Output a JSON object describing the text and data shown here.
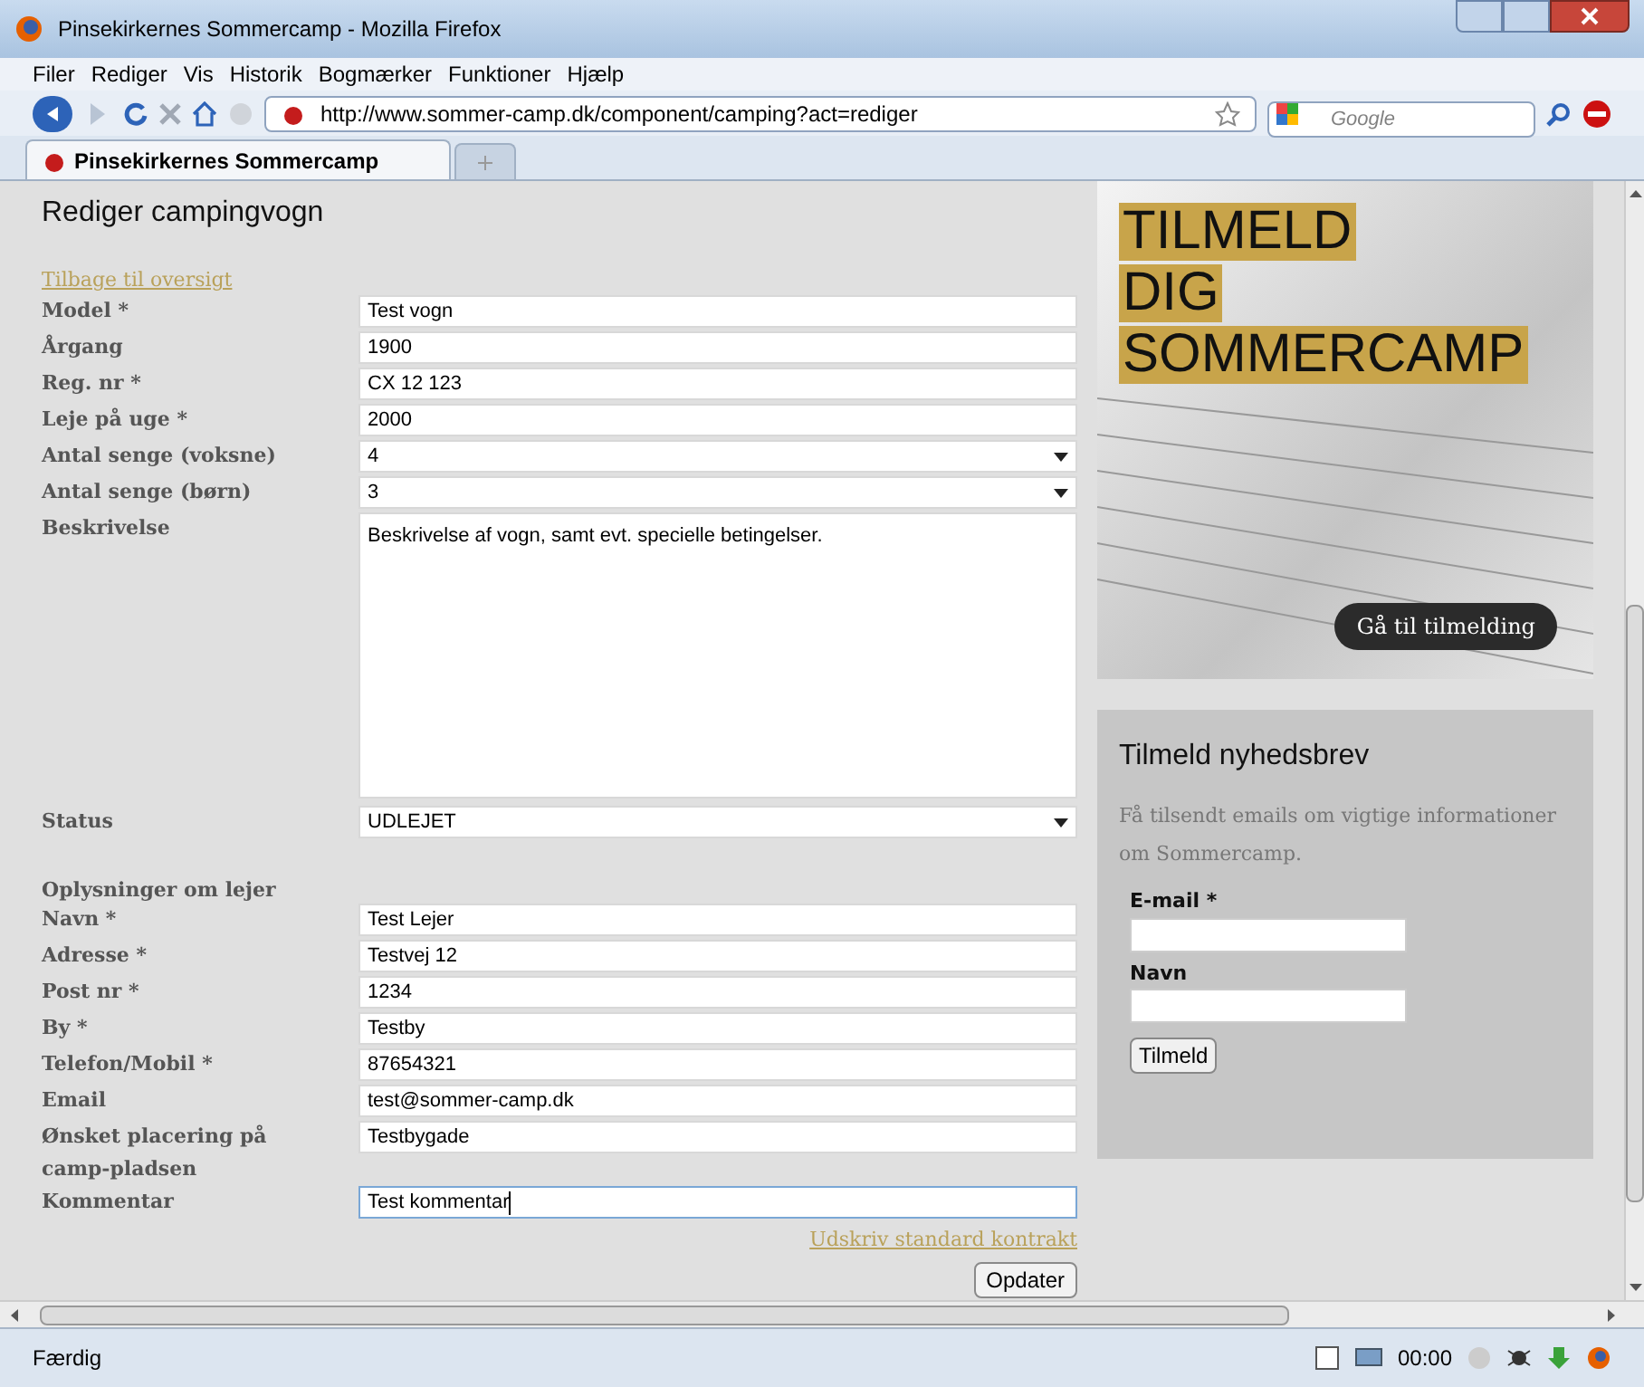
{
  "window": {
    "title": "Pinsekirkernes Sommercamp - Mozilla Firefox"
  },
  "menu": [
    "Filer",
    "Rediger",
    "Vis",
    "Historik",
    "Bogmærker",
    "Funktioner",
    "Hjælp"
  ],
  "toolbar": {
    "url": "http://www.sommer-camp.dk/component/camping?act=rediger",
    "search_placeholder": "Google"
  },
  "tabs": [
    {
      "label": "Pinsekirkernes Sommercamp",
      "selected": true
    }
  ],
  "page": {
    "heading": "Rediger campingvogn",
    "back_link": "Tilbage til oversigt",
    "fields": [
      {
        "label": "Model *",
        "kind": "text",
        "value": "Test vogn"
      },
      {
        "label": "Årgang",
        "kind": "text",
        "value": "1900"
      },
      {
        "label": "Reg. nr *",
        "kind": "text",
        "value": "CX 12 123"
      },
      {
        "label": "Leje på uge *",
        "kind": "text",
        "value": "2000"
      },
      {
        "label": "Antal senge (voksne)",
        "kind": "select",
        "value": "4"
      },
      {
        "label": "Antal senge (børn)",
        "kind": "select",
        "value": "3"
      },
      {
        "label": "Beskrivelse",
        "kind": "textarea",
        "value": "Beskrivelse af vogn, samt evt. specielle betingelser."
      },
      {
        "label": "Status",
        "kind": "select",
        "value": "UDLEJET"
      }
    ],
    "tenant_heading": "Oplysninger om lejer",
    "tenant_fields": [
      {
        "label": "Navn *",
        "kind": "text",
        "value": "Test Lejer"
      },
      {
        "label": "Adresse *",
        "kind": "text",
        "value": "Testvej 12"
      },
      {
        "label": "Post nr *",
        "kind": "text",
        "value": "1234"
      },
      {
        "label": "By *",
        "kind": "text",
        "value": "Testby"
      },
      {
        "label": "Telefon/Mobil *",
        "kind": "text",
        "value": "87654321"
      },
      {
        "label": "Email",
        "kind": "text",
        "value": "test@sommer-camp.dk"
      },
      {
        "label": "Ønsket placering på camp-pladsen",
        "kind": "text",
        "value": "Testbygade"
      },
      {
        "label": "Kommentar",
        "kind": "text",
        "value": "Test kommentar",
        "focused": true
      }
    ],
    "print_link": "Udskriv standard kontrakt",
    "submit": "Opdater"
  },
  "banner": {
    "lines": [
      "TILMELD",
      "DIG",
      "SOMMERCAMP"
    ],
    "button": "Gå til tilmelding"
  },
  "newsletter": {
    "title": "Tilmeld nyhedsbrev",
    "text": "Få tilsendt emails om vigtige informationer om Sommercamp.",
    "fields": [
      {
        "label": "E-mail *"
      },
      {
        "label": "Navn"
      }
    ],
    "button": "Tilmeld"
  },
  "status_bar": {
    "text": "Færdig",
    "clock": "00:00"
  }
}
